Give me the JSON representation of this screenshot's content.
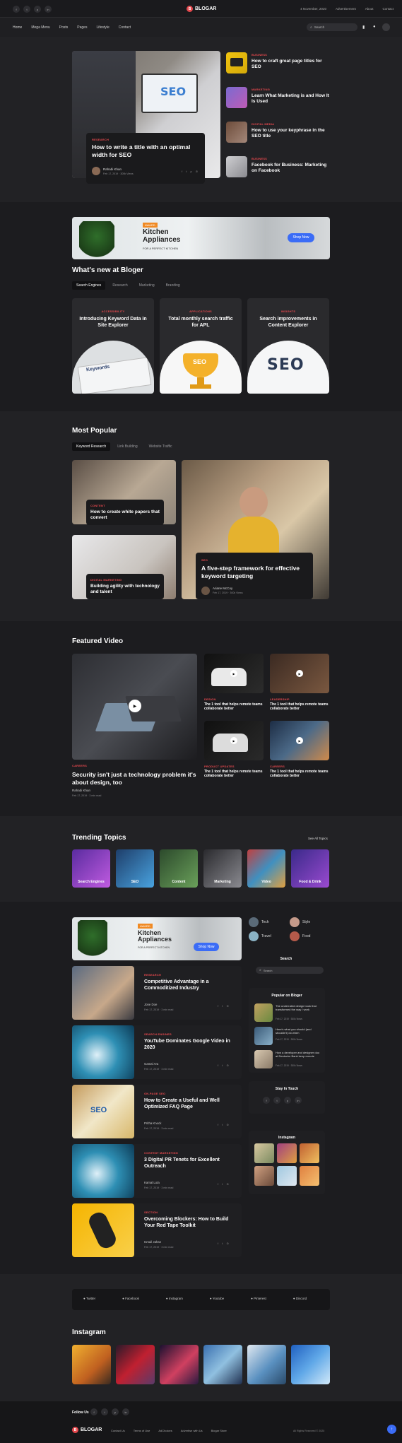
{
  "topbar": {
    "date": "4 November, 2020",
    "links": [
      "Advertisement",
      "About",
      "Contact"
    ],
    "social": [
      "f",
      "t",
      "p",
      "in"
    ]
  },
  "brand": {
    "name": "BLOGAR",
    "logo_letter": "B"
  },
  "nav": {
    "items": [
      "Home",
      "Mega Menu",
      "Posts",
      "Pages",
      "Lifestyle",
      "Contact"
    ],
    "search_placeholder": "Search"
  },
  "hero": {
    "main": {
      "tag": "RESEARCH",
      "title": "How to write a title with an optimal width for SEO",
      "author": "Rahabi Khan",
      "date": "Feb 17, 2019",
      "read": "300k Views"
    },
    "side": [
      {
        "tag": "BUSINESS",
        "title": "How to craft great page titles for SEO"
      },
      {
        "tag": "MARKETING",
        "title": "Learn What Marketing is and How It Is Used"
      },
      {
        "tag": "DIGITAL MEDIA",
        "title": "How to use your keyphrase in the SEO title"
      },
      {
        "tag": "BUSINESS",
        "title": "Facebook for Business: Marketing on Facebook"
      }
    ]
  },
  "ad": {
    "badge": "AWARD",
    "title": "Kitchen Appliances",
    "sub": "FOR A PERFECT KITCHEN",
    "btn": "Shop Now"
  },
  "whatsnew": {
    "title": "What's new at Bloger",
    "tabs": [
      "Search Engines",
      "Research",
      "Marketing",
      "Branding"
    ],
    "cards": [
      {
        "tag": "ACCESSIBILITY",
        "title": "Introducing Keyword Data in Site Explorer",
        "img_text": "Keywords"
      },
      {
        "tag": "APPLICATIONS",
        "title": "Total monthly search traffic for APL",
        "img_text": "SEO"
      },
      {
        "tag": "INSIGHTS",
        "title": "Search improvements in Content Explorer",
        "img_text": "SEO"
      }
    ]
  },
  "popular": {
    "title": "Most Popular",
    "tabs": [
      "Keyword Research",
      "Link Building",
      "Website Traffic"
    ],
    "items": [
      {
        "tag": "CONTENT",
        "title": "How to create white papers that convert"
      },
      {
        "tag": "DIGITAL MARKETING",
        "title": "Building agility with technology and talent"
      },
      {
        "tag": "SEO",
        "title": "A five-step framework for effective keyword targeting",
        "author": "Ariane McCoy",
        "date": "Feb 17, 2019",
        "read": "300k Views"
      }
    ]
  },
  "video": {
    "title": "Featured Video",
    "main": {
      "tag": "CAREERS",
      "title": "Security isn't just a technology problem it's about design, too",
      "author": "Rahabi Khan",
      "date": "Feb 17, 2019",
      "read": "3 min read"
    },
    "small": [
      {
        "tag": "DESIGN",
        "title": "The 1 tool that helps remote teams collaborate better"
      },
      {
        "tag": "LEADERSHIP",
        "title": "The 1 tool that helps remote teams collaborate better"
      },
      {
        "tag": "PRODUCT UPDATES",
        "title": "The 1 tool that helps remote teams collaborate better"
      },
      {
        "tag": "CAREERS",
        "title": "The 1 tool that helps remote teams collaborate better"
      }
    ]
  },
  "trending": {
    "title": "Trending Topics",
    "see_all": "See All Topics",
    "items": [
      "Search Engines",
      "SEO",
      "Content",
      "Marketing",
      "Video",
      "Food & Drink"
    ]
  },
  "posts": [
    {
      "tag": "RESEARCH",
      "title": "Competitive Advantage in a Commoditized Industry",
      "author": "Jone Doe",
      "date": "Feb 17, 2019",
      "read": "3 min read"
    },
    {
      "tag": "SEARCH ENGINES",
      "title": "YouTube Dominates Google Video in 2020",
      "author": "Gamal Ara",
      "date": "Feb 17, 2019",
      "read": "3 min read"
    },
    {
      "tag": "ON-PAGE SEO",
      "title": "How to Create a Useful and Well Optimized FAQ Page",
      "author": "Pritha Knock",
      "date": "Feb 17, 2019",
      "read": "3 min read"
    },
    {
      "tag": "CONTENT MARKETING",
      "title": "3 Digital PR Tenets for Excellent Outreach",
      "author": "Kamal Lota",
      "date": "Feb 17, 2019",
      "read": "3 min read"
    },
    {
      "tag": "SECTION",
      "title": "Overcoming Blockers: How to Build Your Red Tape Toolkit",
      "author": "Ismail Jahan",
      "date": "Feb 17, 2019",
      "read": "3 min read"
    }
  ],
  "sidebar": {
    "cats": [
      "Tech",
      "Style",
      "Travel",
      "Food"
    ],
    "search_title": "Search",
    "search_placeholder": "Search",
    "popular_title": "Popular on Bloger",
    "popular": [
      {
        "title": "The underrated design book that transformed the way I work",
        "date": "Feb 17, 2019",
        "read": "300k Views"
      },
      {
        "title": "Here's what you should (and shouldn't) do when",
        "date": "Feb 17, 2019",
        "read": "300k Views"
      },
      {
        "title": "How a developer and designer duo at Deutsche Bank keep remote",
        "date": "Feb 17, 2019",
        "read": "300k Views"
      }
    ],
    "touch_title": "Stay In Touch",
    "insta_title": "Instagram"
  },
  "social_bar": [
    "Twitter",
    "Facebook",
    "Instagram",
    "Youtube",
    "Pinterest",
    "Discord"
  ],
  "instagram": {
    "title": "Instagram"
  },
  "footer": {
    "follow": "Follow Us",
    "links": [
      "Contact Us",
      "Terms of Use",
      "AdChoices",
      "Advertise with Us",
      "Blogar Store"
    ],
    "copyright": "All Rights Reserved © 2020"
  },
  "colors": {
    "accent": "#e5484d",
    "blue": "#3b6cf6",
    "bg": "#222225"
  }
}
